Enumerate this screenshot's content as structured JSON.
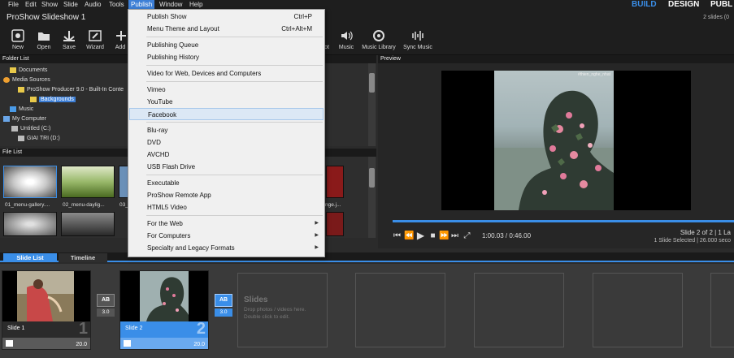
{
  "menubar": {
    "items": [
      "File",
      "Edit",
      "Show",
      "Slide",
      "Audio",
      "Tools",
      "Publish",
      "Window",
      "Help"
    ],
    "modes": [
      "BUILD",
      "DESIGN",
      "PUBL"
    ]
  },
  "titlebar": {
    "title": "ProShow Slideshow 1",
    "slide_count": "2 slides (0"
  },
  "toolbar": {
    "new": "New",
    "open": "Open",
    "save": "Save",
    "wizard": "Wizard",
    "add": "Add",
    "shot": "ot",
    "music": "Music",
    "music_library": "Music Library",
    "sync_music": "Sync Music"
  },
  "folder_panel": {
    "header": "Folder List",
    "items": [
      "Documents",
      "Media Sources",
      "ProShow Producer 9.0 - Built-In Conte",
      "Backgrounds",
      "Music",
      "My Computer",
      "Untitled (C:)",
      "GIAI TRI (D:)"
    ]
  },
  "file_panel": {
    "header": "File List",
    "files": [
      "01_menu-gallery....",
      "02_menu-daylig...",
      "03_",
      "nge.j..."
    ]
  },
  "publish_menu": {
    "publish_show": "Publish Show",
    "publish_show_shortcut": "Ctrl+P",
    "menu_theme": "Menu Theme and Layout",
    "menu_theme_shortcut": "Ctrl+Alt+M",
    "publishing_queue": "Publishing Queue",
    "publishing_history": "Publishing History",
    "video_web": "Video for Web, Devices and Computers",
    "vimeo": "Vimeo",
    "youtube": "YouTube",
    "facebook": "Facebook",
    "bluray": "Blu-ray",
    "dvd": "DVD",
    "avchd": "AVCHD",
    "usb": "USB Flash Drive",
    "executable": "Executable",
    "remote_app": "ProShow Remote App",
    "html5": "HTML5 Video",
    "for_web": "For the Web",
    "for_computers": "For Computers",
    "legacy": "Specialty and Legacy Formats"
  },
  "preview": {
    "header": "Preview",
    "time": "1:00.03 / 0:46.00",
    "slide_position": "Slide 2 of 2  |  1 La",
    "slide_selected": "1 Slide Selected  |  26.000 seco",
    "watermark": "#thien_nghe_nhat"
  },
  "tabs": {
    "slide_list": "Slide List",
    "timeline": "Timeline"
  },
  "slides": [
    {
      "name": "Slide 1",
      "number": "1",
      "duration": "20.0",
      "transition_duration": "3.0"
    },
    {
      "name": "Slide 2",
      "number": "2",
      "duration": "20.0",
      "transition_duration": "3.0"
    }
  ],
  "transition_label": "AB",
  "empty_slot": {
    "title": "Slides",
    "hint1": "Drop photos / videos here.",
    "hint2": "Double click to edit."
  },
  "colors": {
    "accent": "#3a8ee8",
    "menu_active": "#3d7fd6",
    "dropdown_bg": "#f0f0f0"
  }
}
